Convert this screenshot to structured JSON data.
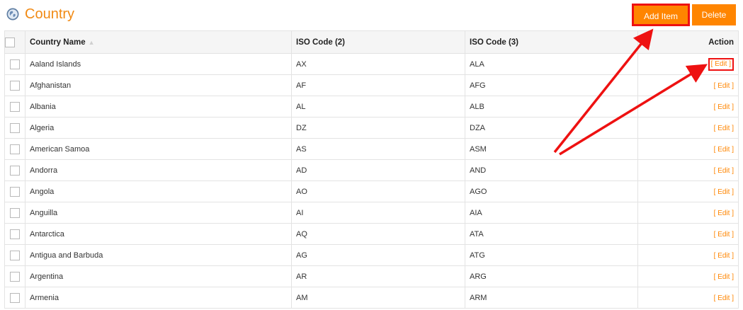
{
  "header": {
    "title": "Country",
    "add_label": "Add Item",
    "delete_label": "Delete"
  },
  "columns": {
    "name": "Country Name",
    "iso2": "ISO Code (2)",
    "iso3": "ISO Code (3)",
    "action": "Action"
  },
  "rows": [
    {
      "name": "Aaland Islands",
      "iso2": "AX",
      "iso3": "ALA"
    },
    {
      "name": "Afghanistan",
      "iso2": "AF",
      "iso3": "AFG"
    },
    {
      "name": "Albania",
      "iso2": "AL",
      "iso3": "ALB"
    },
    {
      "name": "Algeria",
      "iso2": "DZ",
      "iso3": "DZA"
    },
    {
      "name": "American Samoa",
      "iso2": "AS",
      "iso3": "ASM"
    },
    {
      "name": "Andorra",
      "iso2": "AD",
      "iso3": "AND"
    },
    {
      "name": "Angola",
      "iso2": "AO",
      "iso3": "AGO"
    },
    {
      "name": "Anguilla",
      "iso2": "AI",
      "iso3": "AIA"
    },
    {
      "name": "Antarctica",
      "iso2": "AQ",
      "iso3": "ATA"
    },
    {
      "name": "Antigua and Barbuda",
      "iso2": "AG",
      "iso3": "ATG"
    },
    {
      "name": "Argentina",
      "iso2": "AR",
      "iso3": "ARG"
    },
    {
      "name": "Armenia",
      "iso2": "AM",
      "iso3": "ARM"
    }
  ],
  "action_label": "Edit",
  "icons": {
    "title": "globe-icon",
    "sort": "sort-asc-icon"
  },
  "colors": {
    "accent": "#ff8500",
    "title": "#f18a14",
    "annotation": "#ee1111"
  }
}
